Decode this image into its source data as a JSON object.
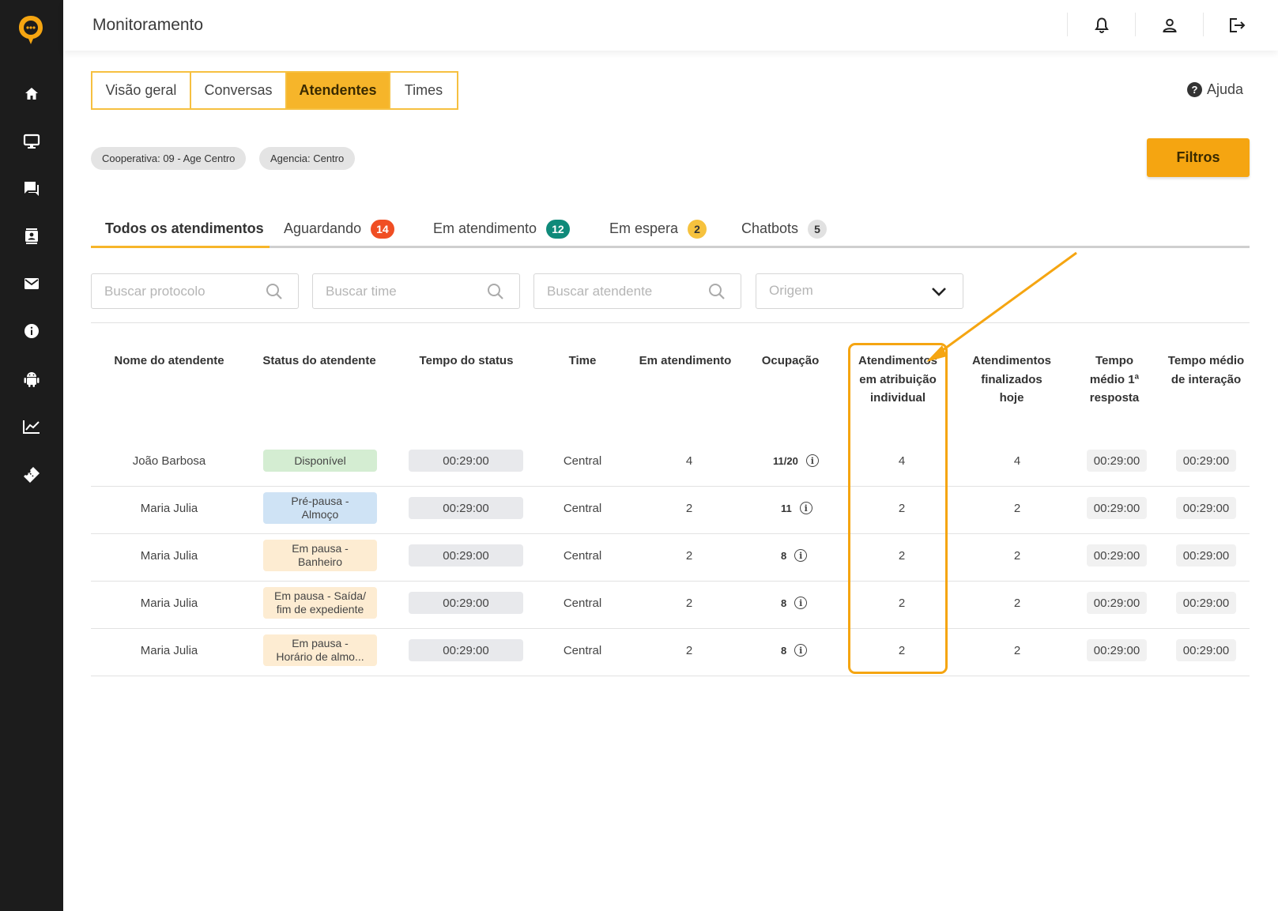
{
  "app": {
    "title": "Monitoramento",
    "brand_color": "#f5a511"
  },
  "sidebar": {
    "items": [
      {
        "icon": "home-icon"
      },
      {
        "icon": "monitor-icon"
      },
      {
        "icon": "chat-icon"
      },
      {
        "icon": "contacts-icon"
      },
      {
        "icon": "mail-icon"
      },
      {
        "icon": "info-icon"
      },
      {
        "icon": "android-icon"
      },
      {
        "icon": "chart-icon"
      },
      {
        "icon": "ticket-icon"
      }
    ]
  },
  "topbar": {
    "icons": [
      "bell-icon",
      "user-icon",
      "logout-icon"
    ]
  },
  "view_tabs": [
    {
      "label": "Visão geral"
    },
    {
      "label": "Conversas"
    },
    {
      "label": "Atendentes",
      "active": true
    },
    {
      "label": "Times"
    }
  ],
  "help": {
    "label": "Ajuda"
  },
  "chips": [
    {
      "label": "Cooperativa: 09 - Age Centro"
    },
    {
      "label": "Agencia: Centro"
    }
  ],
  "filters_button": {
    "label": "Filtros"
  },
  "status_tabs": [
    {
      "label": "Todos os atendimentos",
      "active": true
    },
    {
      "label": "Aguardando",
      "count": "14",
      "color": "#f04e23"
    },
    {
      "label": "Em atendimento",
      "count": "12",
      "color": "#0f8a7a"
    },
    {
      "label": "Em espera",
      "count": "2",
      "color": "#f6c23e"
    },
    {
      "label": "Chatbots",
      "count": "5",
      "color": "#e1e1e1"
    }
  ],
  "search": {
    "protocol_placeholder": "Buscar protocolo",
    "team_placeholder": "Buscar time",
    "agent_placeholder": "Buscar atendente",
    "origin_placeholder": "Origem"
  },
  "table": {
    "headers": {
      "name": "Nome do atendente",
      "status": "Status do atendente",
      "status_time": "Tempo do status",
      "team": "Time",
      "in_service": "Em atendimento",
      "occupancy": "Ocupação",
      "individual_1": "Atendimentos",
      "individual_2": "em atribuição",
      "individual_3": "individual",
      "finished_1": "Atendimentos",
      "finished_2": "finalizados",
      "finished_3": "hoje",
      "first_resp_1": "Tempo",
      "first_resp_2": "médio 1ª",
      "first_resp_3": "resposta",
      "interaction_1": "Tempo médio",
      "interaction_2": "de interação"
    },
    "rows": [
      {
        "name": "João Barbosa",
        "status_1": "Disponível",
        "status_2": "",
        "status_color": "#d4edd2",
        "status_time": "00:29:00",
        "team": "Central",
        "in_service": "4",
        "occupancy": "11/20",
        "individual": "4",
        "finished": "4",
        "first_resp": "00:29:00",
        "interaction": "00:29:00"
      },
      {
        "name": "Maria Julia",
        "status_1": "Pré-pausa -",
        "status_2": "Almoço",
        "status_color": "#cfe3f5",
        "status_time": "00:29:00",
        "team": "Central",
        "in_service": "2",
        "occupancy": "11",
        "individual": "2",
        "finished": "2",
        "first_resp": "00:29:00",
        "interaction": "00:29:00"
      },
      {
        "name": "Maria Julia",
        "status_1": "Em pausa -",
        "status_2": "Banheiro",
        "status_color": "#fdecd2",
        "status_time": "00:29:00",
        "team": "Central",
        "in_service": "2",
        "occupancy": "8",
        "individual": "2",
        "finished": "2",
        "first_resp": "00:29:00",
        "interaction": "00:29:00"
      },
      {
        "name": "Maria Julia",
        "status_1": "Em pausa - Saída/",
        "status_2": "fim de expediente",
        "status_color": "#fdecd2",
        "status_time": "00:29:00",
        "team": "Central",
        "in_service": "2",
        "occupancy": "8",
        "individual": "2",
        "finished": "2",
        "first_resp": "00:29:00",
        "interaction": "00:29:00"
      },
      {
        "name": "Maria Julia",
        "status_1": "Em pausa -",
        "status_2": "Horário de almo...",
        "status_color": "#fdecd2",
        "status_time": "00:29:00",
        "team": "Central",
        "in_service": "2",
        "occupancy": "8",
        "individual": "2",
        "finished": "2",
        "first_resp": "00:29:00",
        "interaction": "00:29:00"
      }
    ]
  }
}
